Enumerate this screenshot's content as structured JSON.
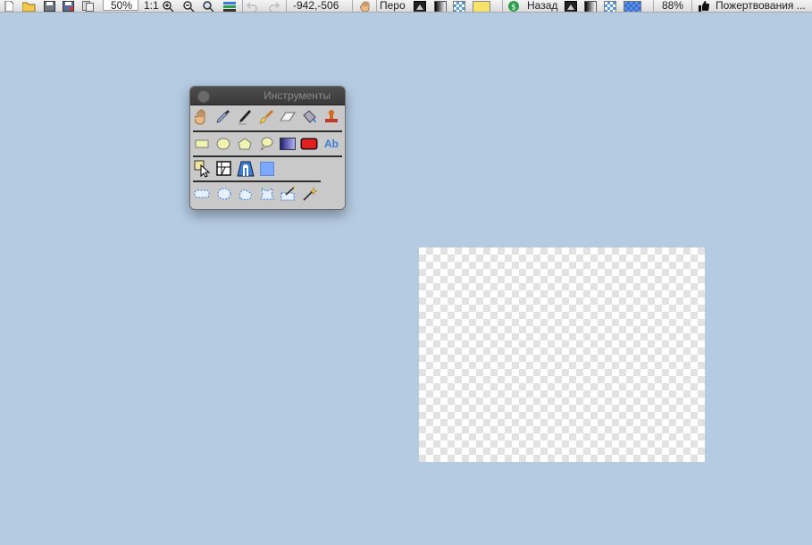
{
  "toolbar": {
    "zoom_value": "50%",
    "actual_size_label": "1:1",
    "coordinates": "-942,-506",
    "tool_name": "Перо",
    "back_label": "Назад",
    "opacity": "88%",
    "donate_label": "Пожертвования ...",
    "icons": [
      "new-icon",
      "open-icon",
      "save-icon",
      "save-as-icon",
      "copy-icon",
      "zoom-in-icon",
      "zoom-out-icon",
      "zoom-fit-icon",
      "layers-icon",
      "undo-icon",
      "redo-icon",
      "hand-icon",
      "color-swap-icon",
      "gradient-icon",
      "checker-icon",
      "yellow-swatch",
      "dollar-icon",
      "back-gradient-icon",
      "blue-checker-icon",
      "thumbs-up-icon"
    ],
    "colors": {
      "primary_swatch": "#f7e36a",
      "secondary_swatch": "#5b8fe6"
    }
  },
  "tools_palette": {
    "title": "Инструменты",
    "rows": [
      [
        "hand-tool",
        "eyedropper-tool",
        "pen-tool",
        "brush-tool",
        "eraser-tool",
        "paint-bucket-tool",
        "stamp-tool"
      ],
      [
        "rectangle-tool",
        "ellipse-tool",
        "polygon-tool",
        "speech-bubble-tool",
        "gradient-tool",
        "rounded-rect-tool",
        "text-tool"
      ],
      [
        "move-selection-tool",
        "crop-tool",
        "perspective-tool",
        "color-swatch-tool"
      ],
      [
        "rect-select-tool",
        "ellipse-select-tool",
        "lasso-select-tool",
        "poly-select-tool",
        "magic-select-tool",
        "magic-wand-tool"
      ]
    ],
    "text_tool_label": "Ab"
  },
  "canvas": {
    "background": "transparent-checkerboard"
  }
}
